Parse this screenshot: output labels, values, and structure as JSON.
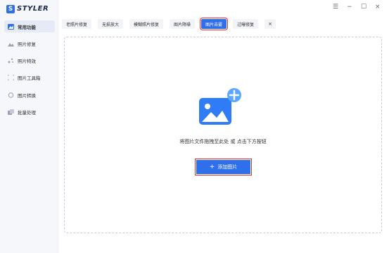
{
  "app": {
    "logo_letter": "S",
    "logo_text": "STYLER"
  },
  "sidebar": {
    "items": [
      {
        "label": "常用功能",
        "icon": "image-icon",
        "active": true
      },
      {
        "label": "照片修复",
        "icon": "landscape-icon",
        "active": false
      },
      {
        "label": "照片特效",
        "icon": "sparkle-icon",
        "active": false
      },
      {
        "label": "图片工具箱",
        "icon": "crop-icon",
        "active": false
      },
      {
        "label": "图片转换",
        "icon": "convert-icon",
        "active": false
      },
      {
        "label": "批量处理",
        "icon": "batch-icon",
        "active": false
      }
    ]
  },
  "tabs": [
    {
      "label": "老照片修复",
      "active": false
    },
    {
      "label": "无损放大",
      "active": false
    },
    {
      "label": "模糊照片修复",
      "active": false
    },
    {
      "label": "图片降噪",
      "active": false
    },
    {
      "label": "图片去雾",
      "active": true
    },
    {
      "label": "过曝修复",
      "active": false
    }
  ],
  "tab_close": "×",
  "window": {
    "menu": "☰",
    "minimize": "−",
    "maximize": "☐",
    "close": "×"
  },
  "dropzone": {
    "hint": "将图片文件拖拽至此处 或 点击下方按钮",
    "button_label": "添加图片",
    "button_plus": "+"
  },
  "colors": {
    "accent": "#2f6fec",
    "highlight": "#e02d2d"
  }
}
